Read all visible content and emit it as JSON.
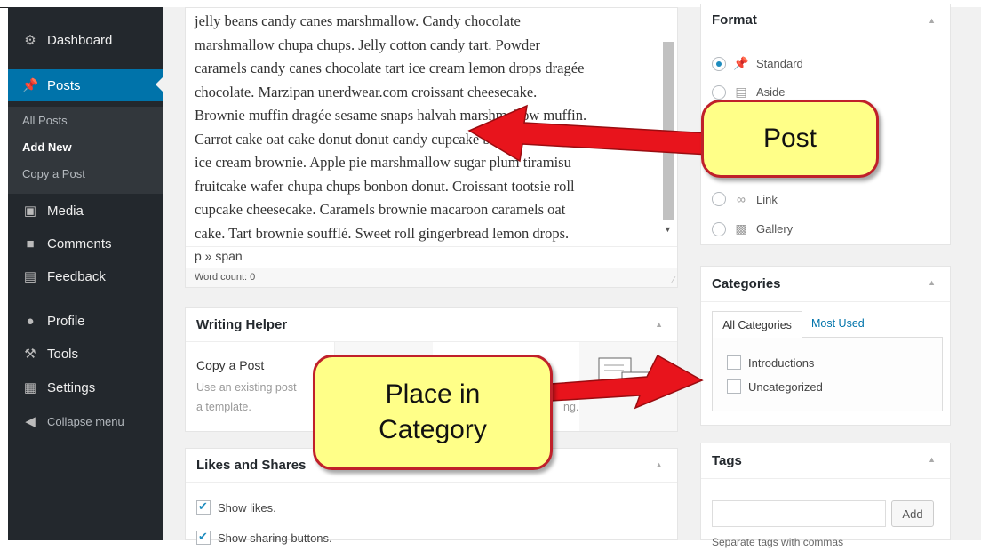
{
  "sidebar": {
    "dashboard": "Dashboard",
    "posts": "Posts",
    "sub_all_posts": "All Posts",
    "sub_add_new": "Add New",
    "sub_copy_post": "Copy a Post",
    "media": "Media",
    "comments": "Comments",
    "feedback": "Feedback",
    "profile": "Profile",
    "tools": "Tools",
    "settings": "Settings",
    "collapse": "Collapse menu"
  },
  "editor": {
    "lines": [
      "jelly beans candy canes marshmallow. Candy chocolate",
      "marshmallow chupa chups. Jelly cotton candy tart. Powder",
      "caramels candy canes chocolate tart ice cream lemon drops dragée",
      "chocolate. Marzipan unerdwear.com croissant cheesecake.",
      "Brownie muffin dragée sesame snaps halvah marshmallow muffin.",
      "Carrot cake oat cake donut donut candy cupcake brownie",
      "ice cream brownie. Apple pie marshmallow sugar plum tiramisu",
      "fruitcake wafer chupa chups bonbon donut. Croissant tootsie roll",
      "cupcake cheesecake. Caramels brownie macaroon caramels oat",
      "cake. Tart brownie soufflé. Sweet roll gingerbread lemon drops."
    ],
    "path": "p » span",
    "word_count": "Word count: 0"
  },
  "writing_helper": {
    "title": "Writing Helper",
    "copy_title": "Copy a Post",
    "desc_line1": "Use an existing post",
    "desc_line2": "a template.",
    "desc_tail": "ng."
  },
  "likes": {
    "title": "Likes and Shares",
    "show_likes": "Show likes.",
    "show_sharing": "Show sharing buttons."
  },
  "format": {
    "title": "Format",
    "options": [
      "Standard",
      "Aside",
      "Link",
      "Gallery"
    ],
    "selected": "Standard"
  },
  "categories": {
    "title": "Categories",
    "tab_all": "All Categories",
    "tab_most_used": "Most Used",
    "items": [
      "Introductions",
      "Uncategorized"
    ]
  },
  "tags": {
    "title": "Tags",
    "add_label": "Add",
    "hint": "Separate tags with commas"
  },
  "callouts": {
    "post": "Post",
    "place_line1": "Place in",
    "place_line2": "Category"
  },
  "colors": {
    "sidebar_bg": "#23282d",
    "active_menu": "#0073aa",
    "link": "#0073aa",
    "callout_fill": "#ffff88",
    "callout_border": "#c0202a",
    "arrow": "#e8141c"
  }
}
